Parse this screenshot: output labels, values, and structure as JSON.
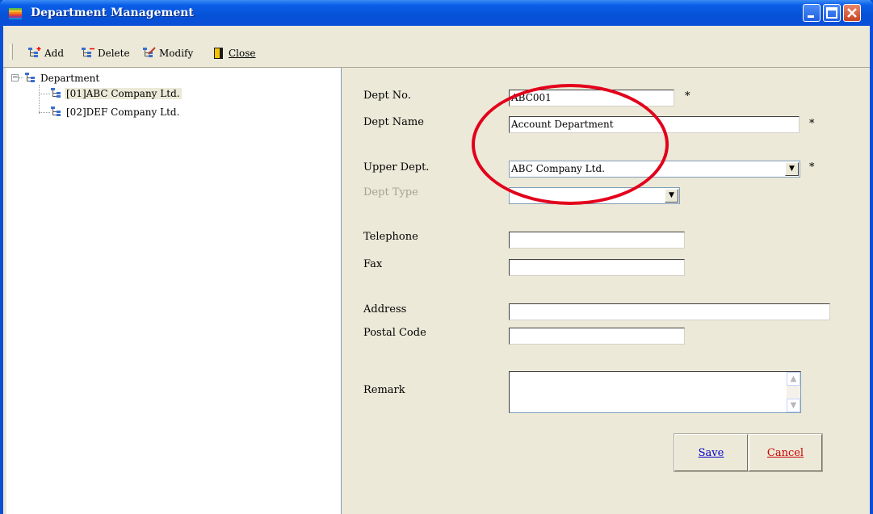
{
  "window": {
    "title": "Department Management",
    "accent": "#0a4fd8"
  },
  "toolbar": {
    "add_label": "Add",
    "delete_label": "Delete",
    "modify_label": "Modify",
    "close_label": "Close"
  },
  "tree": {
    "root": {
      "label": "Department",
      "expander": "−"
    },
    "items": [
      {
        "label": "[01]ABC Company Ltd.",
        "selected": true
      },
      {
        "label": "[02]DEF Company Ltd.",
        "selected": false
      }
    ]
  },
  "form": {
    "dept_no": {
      "label": "Dept No.",
      "value": "ABC001",
      "required_mark": "*"
    },
    "dept_name": {
      "label": "Dept Name",
      "value": "Account Department",
      "required_mark": "*"
    },
    "upper_dept": {
      "label": "Upper Dept.",
      "value": "ABC Company Ltd.",
      "required_mark": "*"
    },
    "dept_type": {
      "label": "Dept Type",
      "value": ""
    },
    "telephone": {
      "label": "Telephone",
      "value": ""
    },
    "fax": {
      "label": "Fax",
      "value": ""
    },
    "address": {
      "label": "Address",
      "value": ""
    },
    "postal_code": {
      "label": "Postal Code",
      "value": ""
    },
    "remark": {
      "label": "Remark",
      "value": ""
    }
  },
  "buttons": {
    "save_label": "Save",
    "cancel_label": "Cancel",
    "save_color": "#0000cc",
    "cancel_color": "#cc0000"
  },
  "annotation": {
    "color": "#e3001b"
  }
}
